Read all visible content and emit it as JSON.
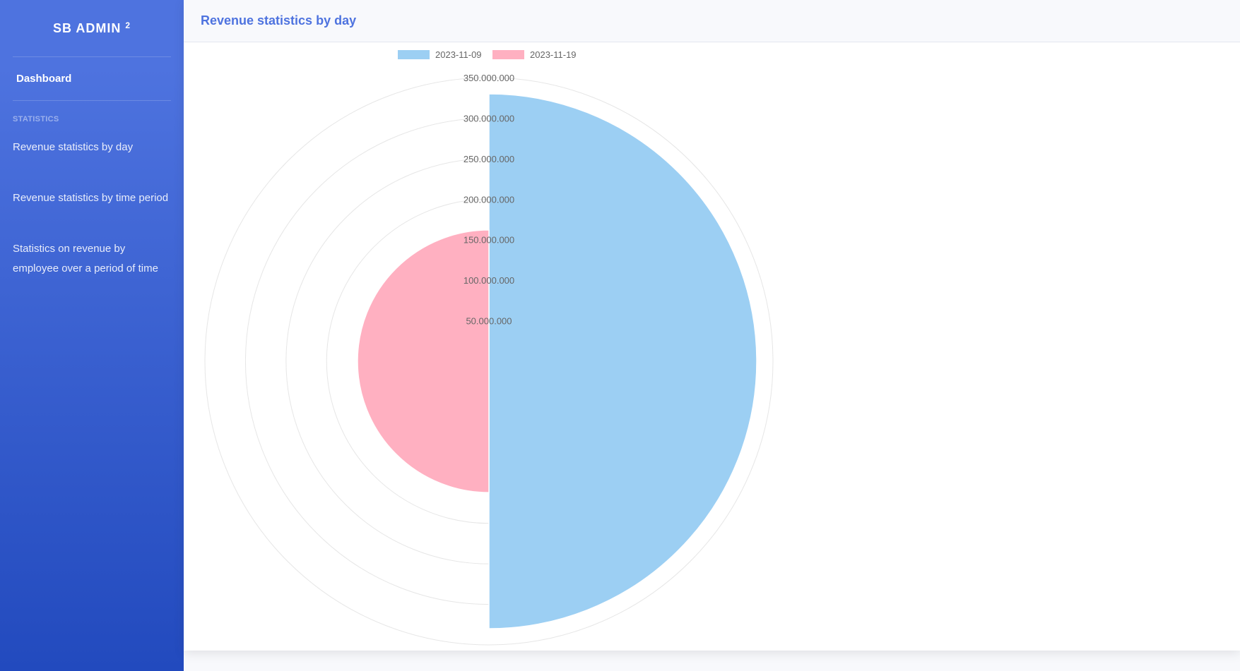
{
  "sidebar": {
    "brand": "SB ADMIN",
    "brand_sup": "2",
    "dashboard": "Dashboard",
    "heading": "STATISTICS",
    "items": [
      {
        "label": "Revenue statistics by day"
      },
      {
        "label": "Revenue statistics by time period"
      },
      {
        "label": "Statistics on revenue by employee over a period of time"
      }
    ]
  },
  "main": {
    "title": "Revenue statistics by day"
  },
  "chart_data": {
    "type": "polarArea",
    "categories": [
      "2023-11-09",
      "2023-11-19"
    ],
    "values": [
      330000000,
      162000000
    ],
    "colors": [
      "#9ccff3",
      "#ffb0c1"
    ],
    "rlim": [
      0,
      350000000
    ],
    "ticks": [
      "50.000.000",
      "100.000.000",
      "150.000.000",
      "200.000.000",
      "250.000.000",
      "300.000.000",
      "350.000.000"
    ],
    "legend_position": "top",
    "grid": true
  }
}
